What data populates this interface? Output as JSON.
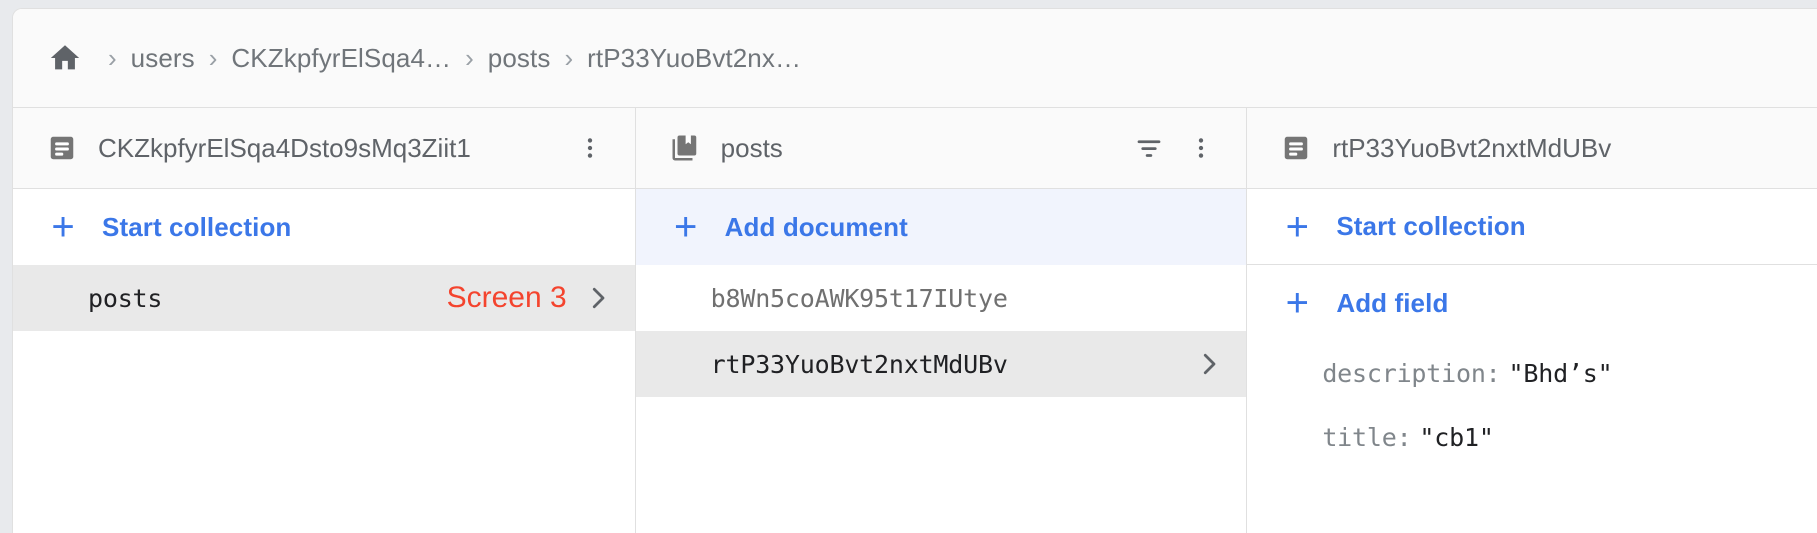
{
  "breadcrumb": {
    "home_icon": "home-icon",
    "separator": "›",
    "items": [
      {
        "label": "users"
      },
      {
        "label": "CKZkpfyrElSqa4…"
      },
      {
        "label": "posts"
      },
      {
        "label": "rtP33YuoBvt2nx…"
      }
    ]
  },
  "colors": {
    "accent_blue": "#3b77e8",
    "annotation_red": "#f4442e",
    "selected_row_gray": "#e9e9e9",
    "highlight_blue": "#f1f4fd",
    "header_gray": "#fafafa",
    "text_gray": "#5f6368",
    "border_gray": "#e0e0e0"
  },
  "panels": [
    {
      "id": "document-panel-left",
      "icon": "document-icon",
      "title": "CKZkpfyrElSqa4Dsto9sMq3Ziit1",
      "menu_icon": "more-vert-icon",
      "add_action": {
        "label": "Start collection",
        "icon": "plus-icon",
        "highlight": false
      },
      "rows": [
        {
          "label": "posts",
          "selected": true,
          "annotation": "Screen 3",
          "chevron": true
        }
      ]
    },
    {
      "id": "collection-panel-posts",
      "icon": "collection-icon",
      "title": "posts",
      "filter_icon": "filter-icon",
      "menu_icon": "more-vert-icon",
      "add_action": {
        "label": "Add document",
        "icon": "plus-icon",
        "highlight": true
      },
      "rows": [
        {
          "label": "b8Wn5coAWK95t17IUtye",
          "selected": false,
          "annotation": "",
          "chevron": false
        },
        {
          "label": "rtP33YuoBvt2nxtMdUBv",
          "selected": true,
          "annotation": "",
          "chevron": true
        }
      ]
    },
    {
      "id": "document-panel-right",
      "icon": "document-icon",
      "title": "rtP33YuoBvt2nxtMdUBv",
      "add_action": {
        "label": "Start collection",
        "icon": "plus-icon",
        "highlight": false
      },
      "add_field_action": {
        "label": "Add field",
        "icon": "plus-icon"
      },
      "fields": [
        {
          "key": "description:",
          "value": "\"Bhd’s\""
        },
        {
          "key": "title:",
          "value": "\"cb1\""
        }
      ]
    }
  ]
}
